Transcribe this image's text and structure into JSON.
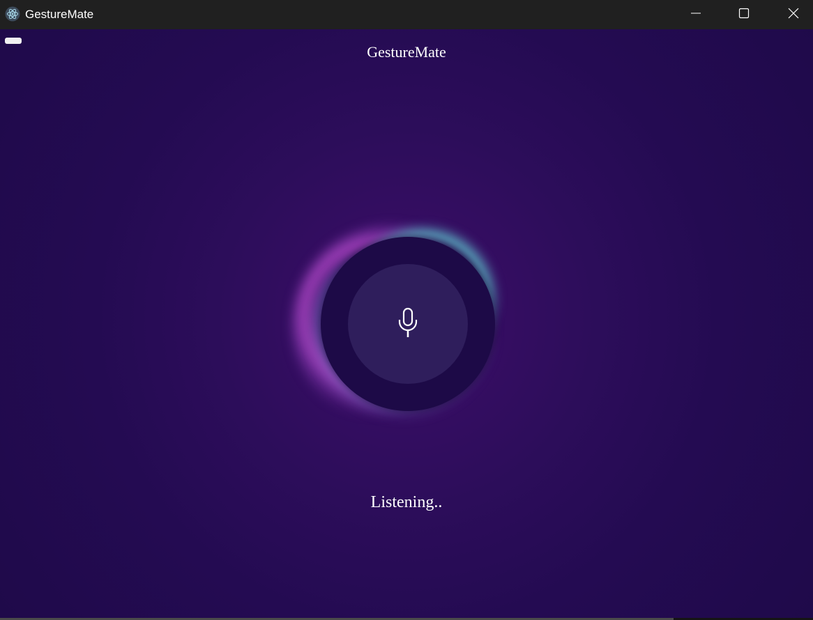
{
  "window": {
    "title": "GestureMate",
    "app_icon": "electron-atom-icon",
    "controls": {
      "minimize_icon": "minimize-icon",
      "maximize_icon": "maximize-icon",
      "close_icon": "close-icon"
    }
  },
  "app": {
    "heading": "GestureMate",
    "menu_button_icon": "menu-pill-icon",
    "mic_button_icon": "microphone-icon",
    "status": "Listening..",
    "colors": {
      "background": "#2a0c58",
      "ring_dark": "#1d0a47",
      "mic_button": "#2f1e5c",
      "glow_purple": "#b94bcd",
      "glow_teal": "#5fc3cd",
      "glow_blue": "#7d8ce1",
      "text": "#ffffff"
    }
  }
}
